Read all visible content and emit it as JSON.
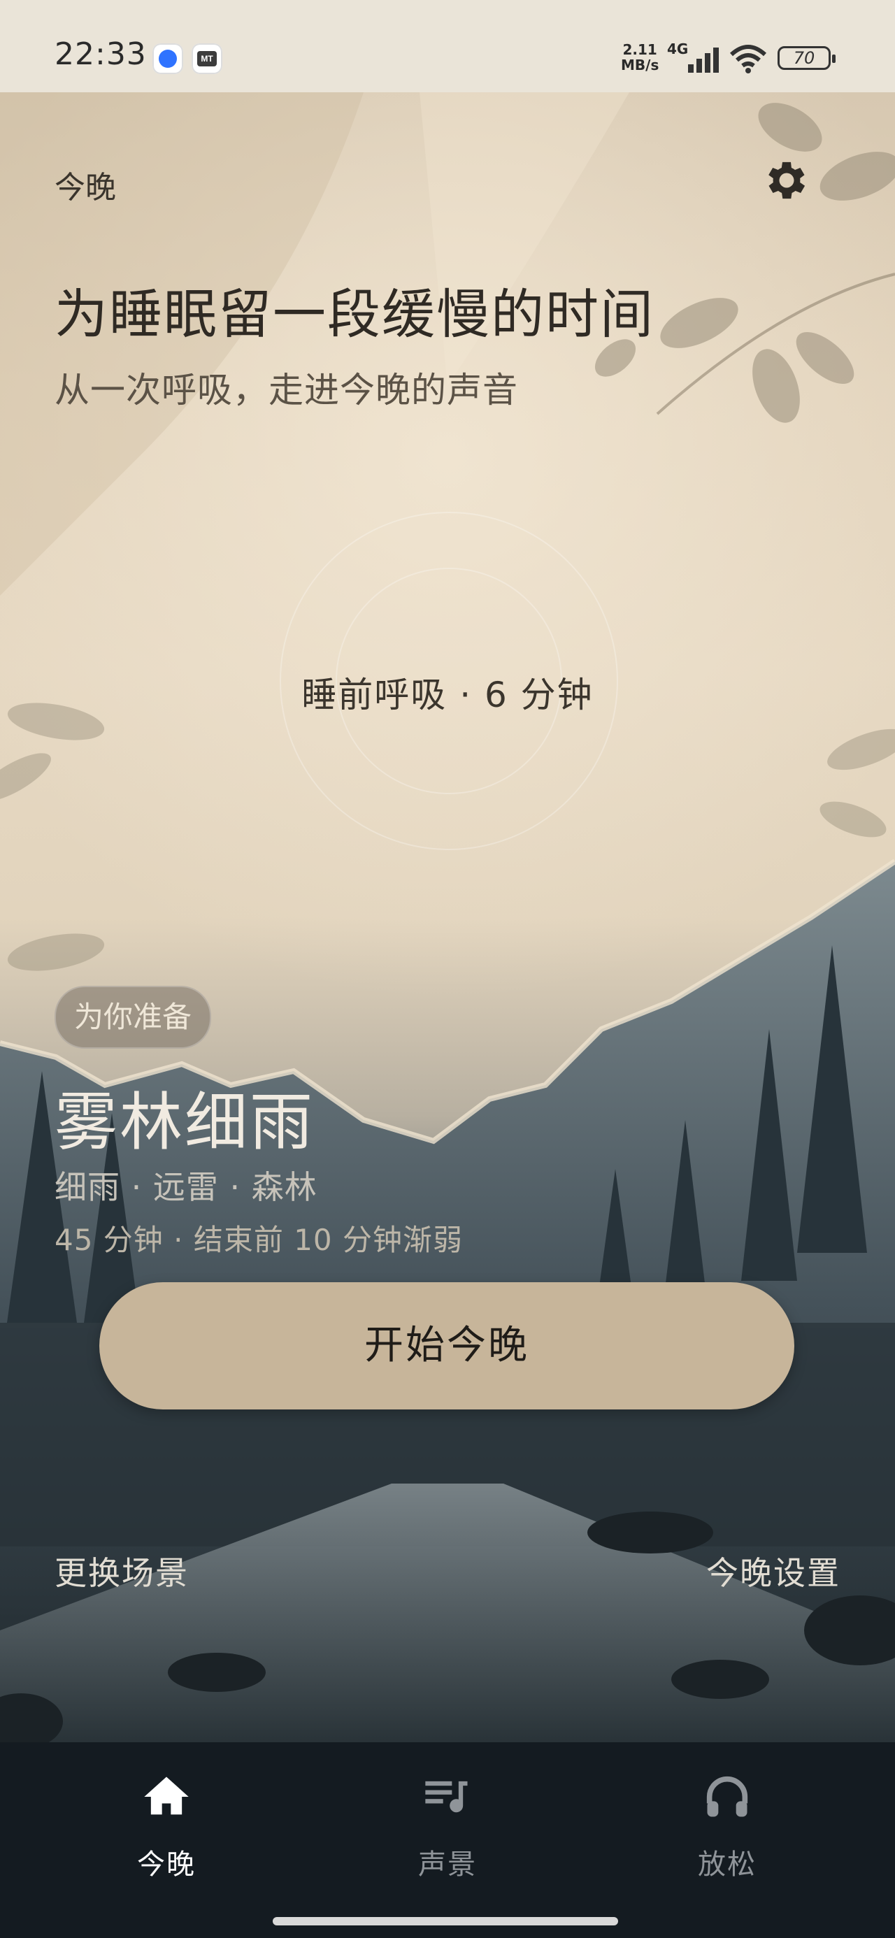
{
  "status_bar": {
    "time": "22:33",
    "net_speed_value": "2.11",
    "net_speed_unit": "MB/s",
    "network": "4G",
    "battery": "70"
  },
  "header": {
    "label": "今晚",
    "settings_icon": "gear-icon"
  },
  "hero": {
    "headline": "为睡眠留一段缓慢的时间",
    "subhead": "从一次呼吸，走进今晚的声音",
    "breath_session": "睡前呼吸 · 6 分钟"
  },
  "recommendation": {
    "chip": "为你准备",
    "title": "雾林细雨",
    "tags": "细雨 · 远雷 · 森林",
    "meta": "45 分钟  ·  结束前 10 分钟渐弱",
    "start_button": "开始今晚"
  },
  "links": {
    "change_scene": "更换场景",
    "tonight_settings": "今晚设置"
  },
  "bottom_nav": {
    "items": [
      {
        "label": "今晚",
        "icon": "home-icon",
        "active": true
      },
      {
        "label": "声景",
        "icon": "playlist-music-icon",
        "active": false
      },
      {
        "label": "放松",
        "icon": "headphones-icon",
        "active": false
      }
    ]
  },
  "colors": {
    "accent_button": "#c7b59a",
    "nav_background": "#141b21",
    "paper": "#e6d8c2"
  }
}
